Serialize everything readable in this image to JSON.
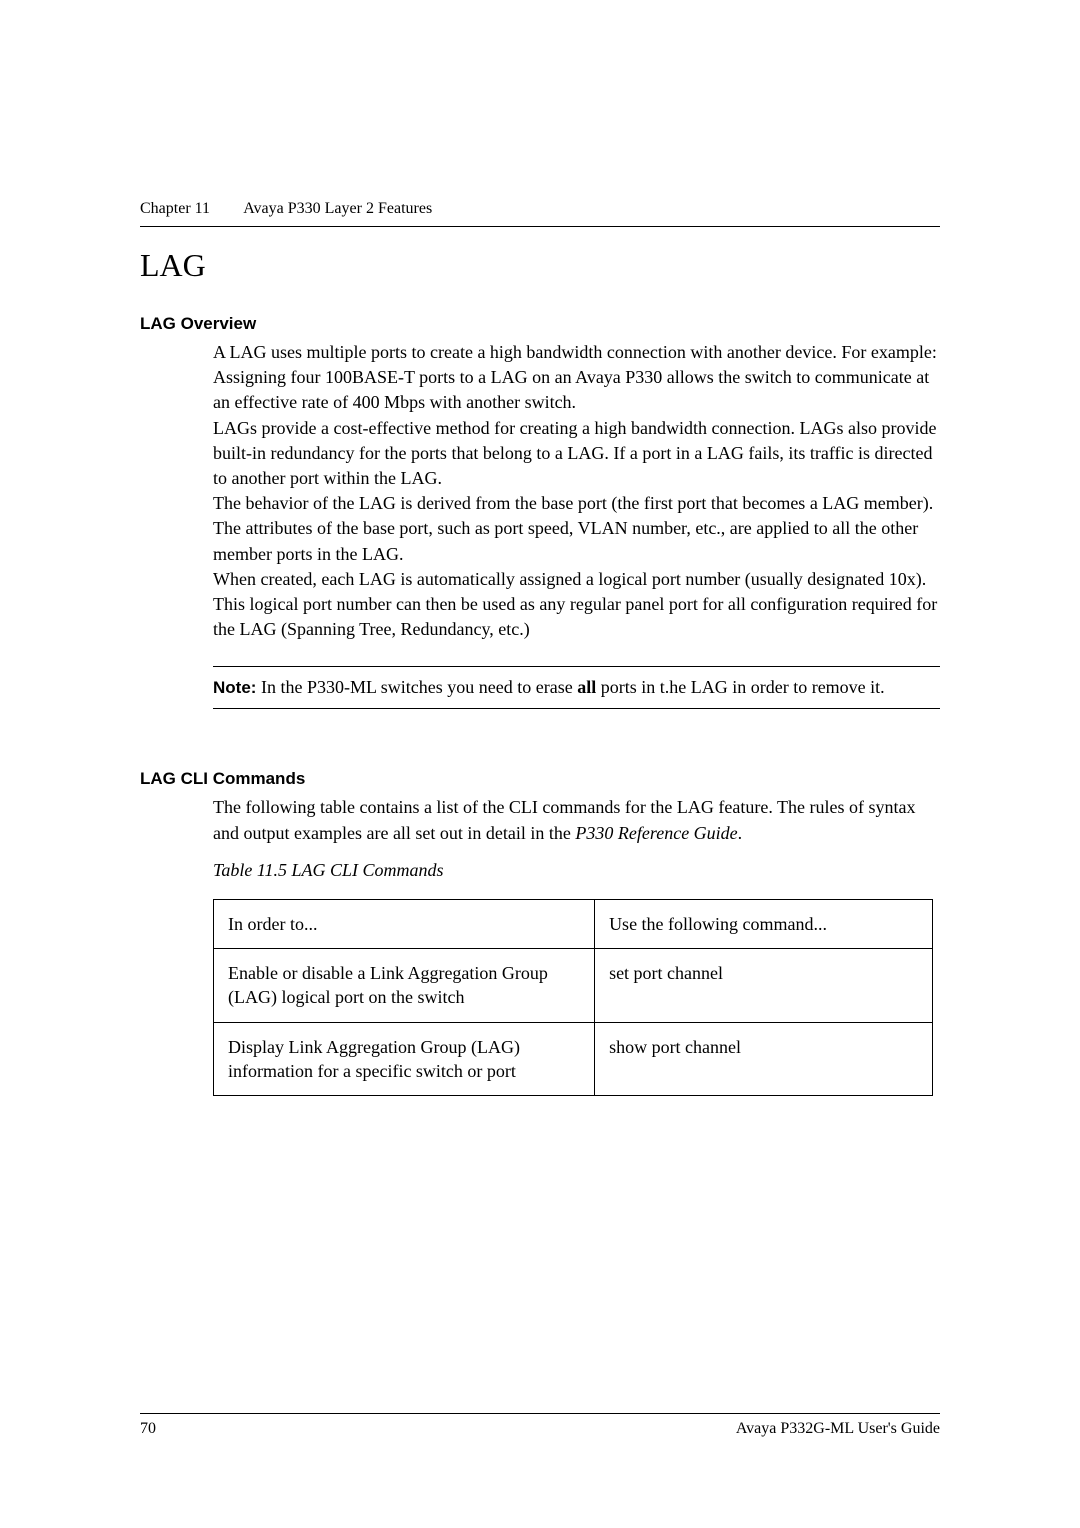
{
  "header": {
    "chapter_label": "Chapter 11",
    "chapter_title": "Avaya P330 Layer 2 Features"
  },
  "section": {
    "title": "LAG"
  },
  "overview": {
    "title": "LAG Overview",
    "para1": "A LAG uses multiple ports to create a high bandwidth connection with another device. For example: Assigning four 100BASE-T ports to a LAG on an Avaya P330 allows the switch to communicate at an effective rate of 400 Mbps with another switch.",
    "para2": "LAGs provide a cost-effective method for creating a high bandwidth connection. LAGs also provide built-in redundancy for the ports that belong to a LAG. If a port in a LAG fails, its traffic is directed to another port within the LAG.",
    "para3": "The behavior of the LAG is derived from the base port (the first port that becomes a LAG member). The attributes of the base port, such as port speed, VLAN number, etc., are applied to all the other member ports in the LAG.",
    "para4": "When created, each LAG is automatically assigned a logical port number (usually designated 10x). This logical port number can then be used as any regular panel port for all configuration required for the LAG (Spanning Tree, Redundancy, etc.)"
  },
  "note": {
    "label": "Note:",
    "text_prefix": "  In the P330-ML switches you need to erase ",
    "bold_word": "all",
    "text_suffix": " ports in t.he LAG in order to remove it."
  },
  "cli": {
    "title": "LAG CLI Commands",
    "intro_prefix": "The following table contains a list of the CLI commands for the LAG feature. The rules of syntax and output examples are all set out in detail in the ",
    "intro_italic": "P330 Reference Guide",
    "intro_suffix": ".",
    "table_caption": "Table 11.5    LAG CLI Commands",
    "col1_header": "In order to...",
    "col2_header": "Use the following command...",
    "rows": [
      {
        "action": "Enable or disable a Link Aggregation Group (LAG) logical port on the switch",
        "command": "set port channel"
      },
      {
        "action": "Display Link Aggregation Group (LAG) information for a specific switch or port",
        "command": "show port channel"
      }
    ]
  },
  "footer": {
    "page_number": "70",
    "doc_title": "Avaya P332G-ML User's Guide"
  }
}
